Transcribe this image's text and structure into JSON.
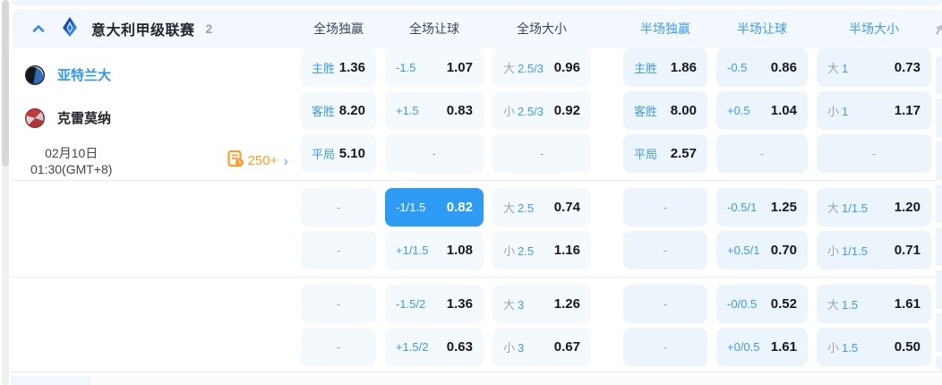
{
  "league": {
    "title": "意大利甲级联赛",
    "count": "2",
    "columns": [
      "全场独赢",
      "全场让球",
      "全场大小",
      "半场独赢",
      "半场让球",
      "半场大小"
    ]
  },
  "match": {
    "home": "亚特兰大",
    "away": "克雷莫纳",
    "date": "02月10日",
    "time": "01:30(GMT+8)",
    "more_markets": "250+",
    "dash": "-"
  },
  "row_groups": [
    [
      [
        {
          "blue": "主胜",
          "value": "1.36"
        },
        {
          "blue": "-1.5",
          "value": "1.07"
        },
        {
          "gray": "大",
          "blue": "2.5/3",
          "value": "0.96"
        },
        {
          "blue": "主胜",
          "value": "1.86"
        },
        {
          "blue": "-0.5",
          "value": "0.86"
        },
        {
          "gray": "大",
          "blue": "1",
          "value": "0.73"
        }
      ],
      [
        {
          "blue": "客胜",
          "value": "8.20"
        },
        {
          "blue": "+1.5",
          "value": "0.83"
        },
        {
          "gray": "小",
          "blue": "2.5/3",
          "value": "0.92"
        },
        {
          "blue": "客胜",
          "value": "8.00"
        },
        {
          "blue": "+0.5",
          "value": "1.04"
        },
        {
          "gray": "小",
          "blue": "1",
          "value": "1.17"
        }
      ],
      [
        {
          "blue": "平局",
          "value": "5.10"
        },
        {
          "dash": true
        },
        {
          "dash": true
        },
        {
          "blue": "平局",
          "value": "2.57"
        },
        {
          "dash": true
        },
        {
          "dash": true
        }
      ]
    ],
    [
      [
        {
          "dash": true
        },
        {
          "blue": "-1/1.5",
          "value": "0.82",
          "selected": true
        },
        {
          "gray": "大",
          "blue": "2.5",
          "value": "0.74"
        },
        {
          "dash": true
        },
        {
          "blue": "-0.5/1",
          "value": "1.25"
        },
        {
          "gray": "大",
          "blue": "1/1.5",
          "value": "1.20"
        }
      ],
      [
        {
          "dash": true
        },
        {
          "blue": "+1/1.5",
          "value": "1.08"
        },
        {
          "gray": "小",
          "blue": "2.5",
          "value": "1.16"
        },
        {
          "dash": true
        },
        {
          "blue": "+0.5/1",
          "value": "0.70"
        },
        {
          "gray": "小",
          "blue": "1/1.5",
          "value": "0.71"
        }
      ]
    ],
    [
      [
        {
          "dash": true
        },
        {
          "blue": "-1.5/2",
          "value": "1.36"
        },
        {
          "gray": "大",
          "blue": "3",
          "value": "1.26"
        },
        {
          "dash": true
        },
        {
          "blue": "-0/0.5",
          "value": "0.52"
        },
        {
          "gray": "大",
          "blue": "1.5",
          "value": "1.61"
        }
      ],
      [
        {
          "dash": true
        },
        {
          "blue": "+1.5/2",
          "value": "0.63"
        },
        {
          "gray": "小",
          "blue": "3",
          "value": "0.67"
        },
        {
          "dash": true
        },
        {
          "blue": "+0/0.5",
          "value": "1.61"
        },
        {
          "gray": "小",
          "blue": "1.5",
          "value": "0.50"
        }
      ]
    ]
  ],
  "colors": {
    "accent_blue": "#3b9afc",
    "selected_bg": "#2e9bf5",
    "value_text": "#17191d",
    "gray_label": "#9aa5b1",
    "cell_bg_full": "#f4f9fe",
    "cell_bg_half": "#ecf4fc",
    "orange": "#fe9d27",
    "header_bg": "#f3f8fe"
  }
}
